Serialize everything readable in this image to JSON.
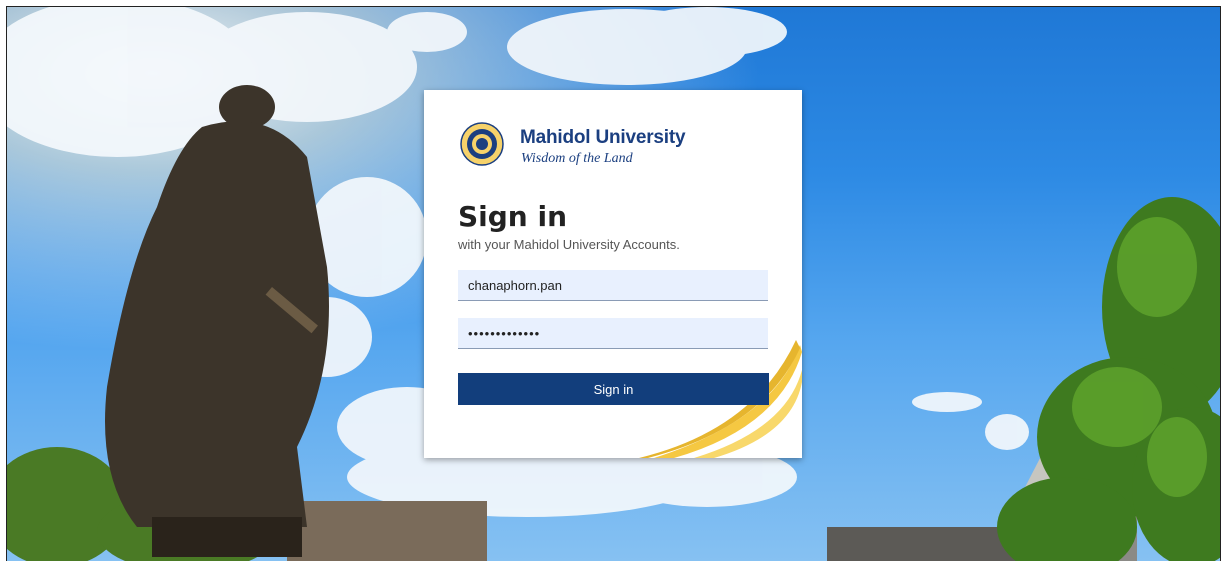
{
  "brand": {
    "name": "Mahidol University",
    "tagline": "Wisdom of the Land",
    "primary_color": "#123e7c",
    "accent_color": "#f5c842"
  },
  "login": {
    "title": "Sign in",
    "subtitle": "with your Mahidol University Accounts.",
    "username_value": "chanaphorn.pan",
    "password_value": "•••••••••••••",
    "submit_label": "Sign in"
  },
  "background": {
    "scene": "statue-sky-trees"
  }
}
